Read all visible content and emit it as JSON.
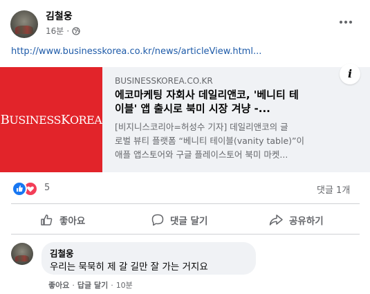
{
  "post": {
    "author": "김철웅",
    "time": "16분",
    "privacy_icon": "globe-icon",
    "more_icon": "more-options-icon",
    "link_text": "http://www.businesskorea.co.kr/news/articleView.html..."
  },
  "card": {
    "logo_text_1": "B",
    "logo_text_2": "USINESS",
    "logo_text_3": "K",
    "logo_text_4": "OREA",
    "domain": "BUSINESSKOREA.CO.KR",
    "title_line1": "에코마케팅 자회사 데일리앤코, '베니티 테",
    "title_line2": "이블' 앱 출시로 북미 시장 겨냥 -...",
    "desc_line1": "[비지니스코리아=허성수 기자] 데일리앤코의 글",
    "desc_line2": "로벌 뷰티 플랫폼 “베니티 테이블(vanity table)”이",
    "desc_line3": "애플 앱스토어와 구글 플레이스토어 북미 마켓...",
    "info_label": "i"
  },
  "stats": {
    "reactions_count": "5",
    "comments_count": "댓글 1개"
  },
  "actions": {
    "like": "좋아요",
    "comment": "댓글 달기",
    "share": "공유하기"
  },
  "comment": {
    "author": "김철웅",
    "text": "우리는 묵묵히 제 갈 길만 잘 가는 거지요",
    "like": "좋아요",
    "sep1": "·",
    "reply": "답글 달기",
    "sep2": "·",
    "time": "10분"
  },
  "colors": {
    "link": "#1d5aa8",
    "like_blue": "#1877f2",
    "love_red": "#f33e58",
    "card_red": "#e2242a",
    "muted": "#65676b"
  }
}
